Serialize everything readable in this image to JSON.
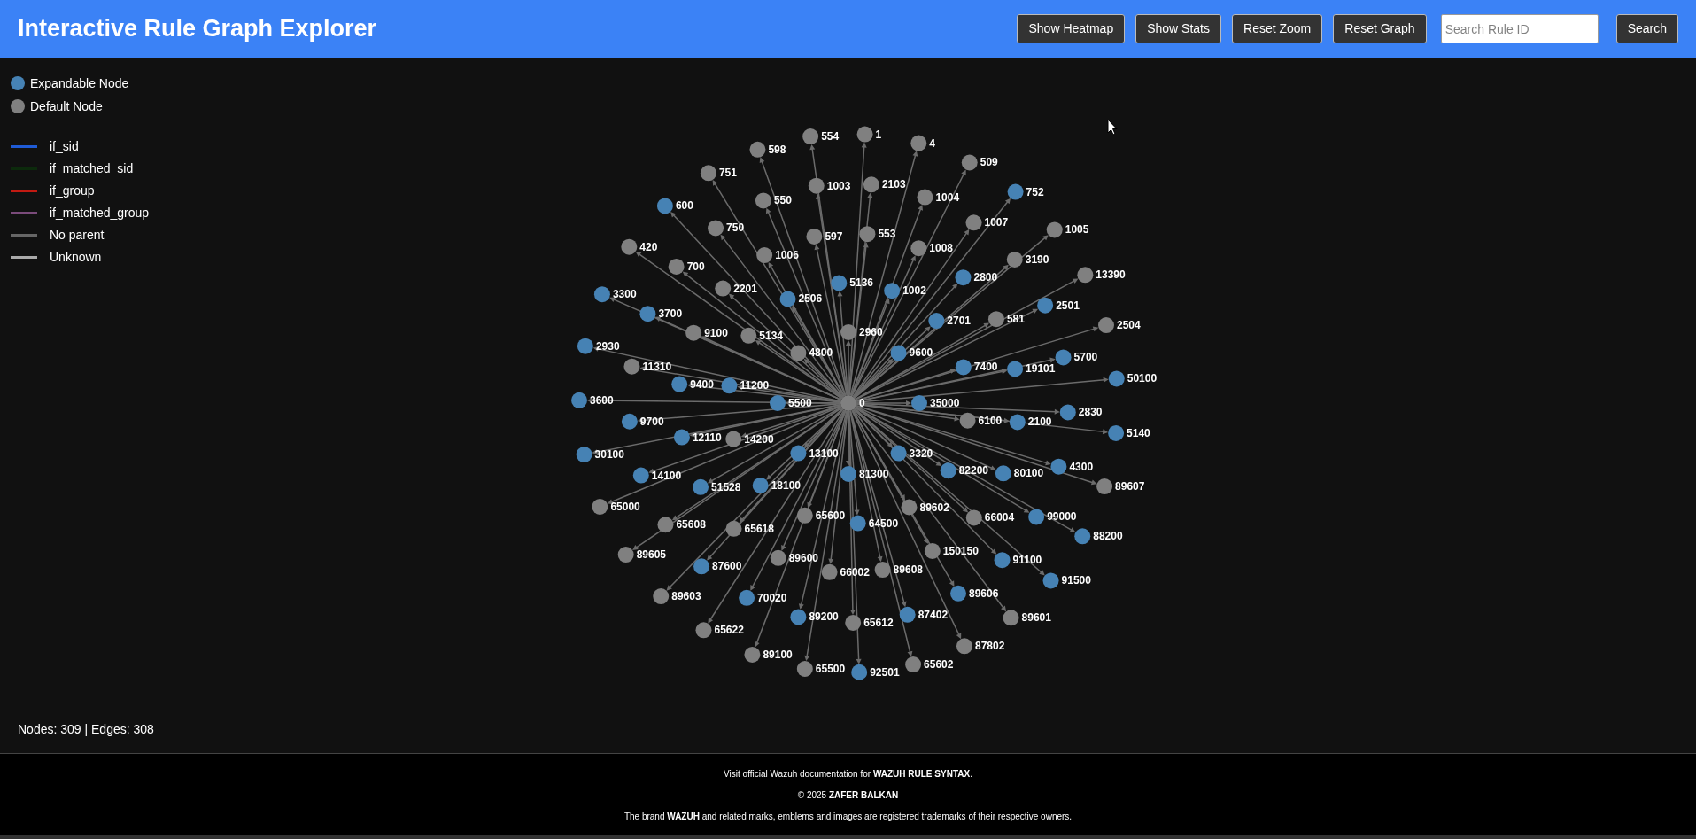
{
  "header": {
    "title": "Interactive Rule Graph Explorer",
    "buttons": [
      "Show Heatmap",
      "Show Stats",
      "Reset Zoom",
      "Reset Graph"
    ],
    "search": {
      "placeholder": "Search Rule ID"
    },
    "search_button": "Search"
  },
  "legend": {
    "nodes": [
      {
        "label": "Expandable Node",
        "color": "#4682b4"
      },
      {
        "label": "Default Node",
        "color": "#808080"
      }
    ],
    "edges": [
      {
        "label": "if_sid",
        "color": "#1f5bd6"
      },
      {
        "label": "if_matched_sid",
        "color": "#0c2a0c"
      },
      {
        "label": "if_group",
        "color": "#c21a12"
      },
      {
        "label": "if_matched_group",
        "color": "#7b4b7b"
      },
      {
        "label": "No parent",
        "color": "#666666"
      },
      {
        "label": "Unknown",
        "color": "#aaaaaa"
      }
    ]
  },
  "graph": {
    "root": {
      "label": "0",
      "expandable": false
    },
    "nodes": [
      {
        "label": "554",
        "expandable": false
      },
      {
        "label": "1",
        "expandable": false
      },
      {
        "label": "4",
        "expandable": false
      },
      {
        "label": "598",
        "expandable": false
      },
      {
        "label": "509",
        "expandable": false
      },
      {
        "label": "751",
        "expandable": false
      },
      {
        "label": "1003",
        "expandable": false
      },
      {
        "label": "2103",
        "expandable": false
      },
      {
        "label": "752",
        "expandable": true
      },
      {
        "label": "550",
        "expandable": false
      },
      {
        "label": "1004",
        "expandable": false
      },
      {
        "label": "600",
        "expandable": true
      },
      {
        "label": "1007",
        "expandable": false
      },
      {
        "label": "750",
        "expandable": false
      },
      {
        "label": "597",
        "expandable": false
      },
      {
        "label": "553",
        "expandable": false
      },
      {
        "label": "1005",
        "expandable": false
      },
      {
        "label": "420",
        "expandable": false
      },
      {
        "label": "1008",
        "expandable": false
      },
      {
        "label": "1006",
        "expandable": false
      },
      {
        "label": "3190",
        "expandable": false
      },
      {
        "label": "700",
        "expandable": false
      },
      {
        "label": "2800",
        "expandable": true
      },
      {
        "label": "13390",
        "expandable": false
      },
      {
        "label": "5136",
        "expandable": true
      },
      {
        "label": "2201",
        "expandable": false
      },
      {
        "label": "3300",
        "expandable": true
      },
      {
        "label": "1002",
        "expandable": true
      },
      {
        "label": "2506",
        "expandable": true
      },
      {
        "label": "2501",
        "expandable": true
      },
      {
        "label": "3700",
        "expandable": true
      },
      {
        "label": "2701",
        "expandable": true
      },
      {
        "label": "581",
        "expandable": false
      },
      {
        "label": "2504",
        "expandable": false
      },
      {
        "label": "9100",
        "expandable": false
      },
      {
        "label": "5134",
        "expandable": false
      },
      {
        "label": "2960",
        "expandable": false
      },
      {
        "label": "2930",
        "expandable": true
      },
      {
        "label": "4800",
        "expandable": false
      },
      {
        "label": "9600",
        "expandable": true
      },
      {
        "label": "5700",
        "expandable": true
      },
      {
        "label": "11310",
        "expandable": false
      },
      {
        "label": "7400",
        "expandable": true
      },
      {
        "label": "19101",
        "expandable": true
      },
      {
        "label": "50100",
        "expandable": true
      },
      {
        "label": "9400",
        "expandable": true
      },
      {
        "label": "11200",
        "expandable": true
      },
      {
        "label": "3600",
        "expandable": true
      },
      {
        "label": "5500",
        "expandable": true
      },
      {
        "label": "35000",
        "expandable": true
      },
      {
        "label": "2830",
        "expandable": true
      },
      {
        "label": "9700",
        "expandable": true
      },
      {
        "label": "6100",
        "expandable": false
      },
      {
        "label": "2100",
        "expandable": true
      },
      {
        "label": "12110",
        "expandable": true
      },
      {
        "label": "5140",
        "expandable": true
      },
      {
        "label": "14200",
        "expandable": false
      },
      {
        "label": "30100",
        "expandable": true
      },
      {
        "label": "13100",
        "expandable": true
      },
      {
        "label": "3320",
        "expandable": true
      },
      {
        "label": "4300",
        "expandable": true
      },
      {
        "label": "14100",
        "expandable": true
      },
      {
        "label": "81300",
        "expandable": true
      },
      {
        "label": "82200",
        "expandable": true
      },
      {
        "label": "80100",
        "expandable": true
      },
      {
        "label": "51528",
        "expandable": true
      },
      {
        "label": "18100",
        "expandable": true
      },
      {
        "label": "89607",
        "expandable": false
      },
      {
        "label": "65000",
        "expandable": false
      },
      {
        "label": "89602",
        "expandable": false
      },
      {
        "label": "65600",
        "expandable": false
      },
      {
        "label": "66004",
        "expandable": false
      },
      {
        "label": "99000",
        "expandable": true
      },
      {
        "label": "65608",
        "expandable": false
      },
      {
        "label": "64500",
        "expandable": true
      },
      {
        "label": "65618",
        "expandable": false
      },
      {
        "label": "88200",
        "expandable": true
      },
      {
        "label": "89605",
        "expandable": false
      },
      {
        "label": "150150",
        "expandable": false
      },
      {
        "label": "89600",
        "expandable": false
      },
      {
        "label": "91100",
        "expandable": true
      },
      {
        "label": "87600",
        "expandable": true
      },
      {
        "label": "66002",
        "expandable": false
      },
      {
        "label": "89608",
        "expandable": false
      },
      {
        "label": "91500",
        "expandable": true
      },
      {
        "label": "89603",
        "expandable": false
      },
      {
        "label": "70020",
        "expandable": true
      },
      {
        "label": "89606",
        "expandable": true
      },
      {
        "label": "89200",
        "expandable": true
      },
      {
        "label": "87402",
        "expandable": true
      },
      {
        "label": "65612",
        "expandable": false
      },
      {
        "label": "89601",
        "expandable": false
      },
      {
        "label": "65622",
        "expandable": false
      },
      {
        "label": "87802",
        "expandable": false
      },
      {
        "label": "89100",
        "expandable": false
      },
      {
        "label": "65500",
        "expandable": false
      },
      {
        "label": "65602",
        "expandable": false
      },
      {
        "label": "92501",
        "expandable": true
      }
    ]
  },
  "stats": "Nodes: 309 | Edges: 308",
  "footer": [
    "Visit official Wazuh documentation for **WAZUH RULE SYNTAX**.",
    "© 2025 **ZAFER BALKAN**",
    "The brand **WAZUH** and related marks, emblems and images are registered trademarks of their respective owners."
  ]
}
